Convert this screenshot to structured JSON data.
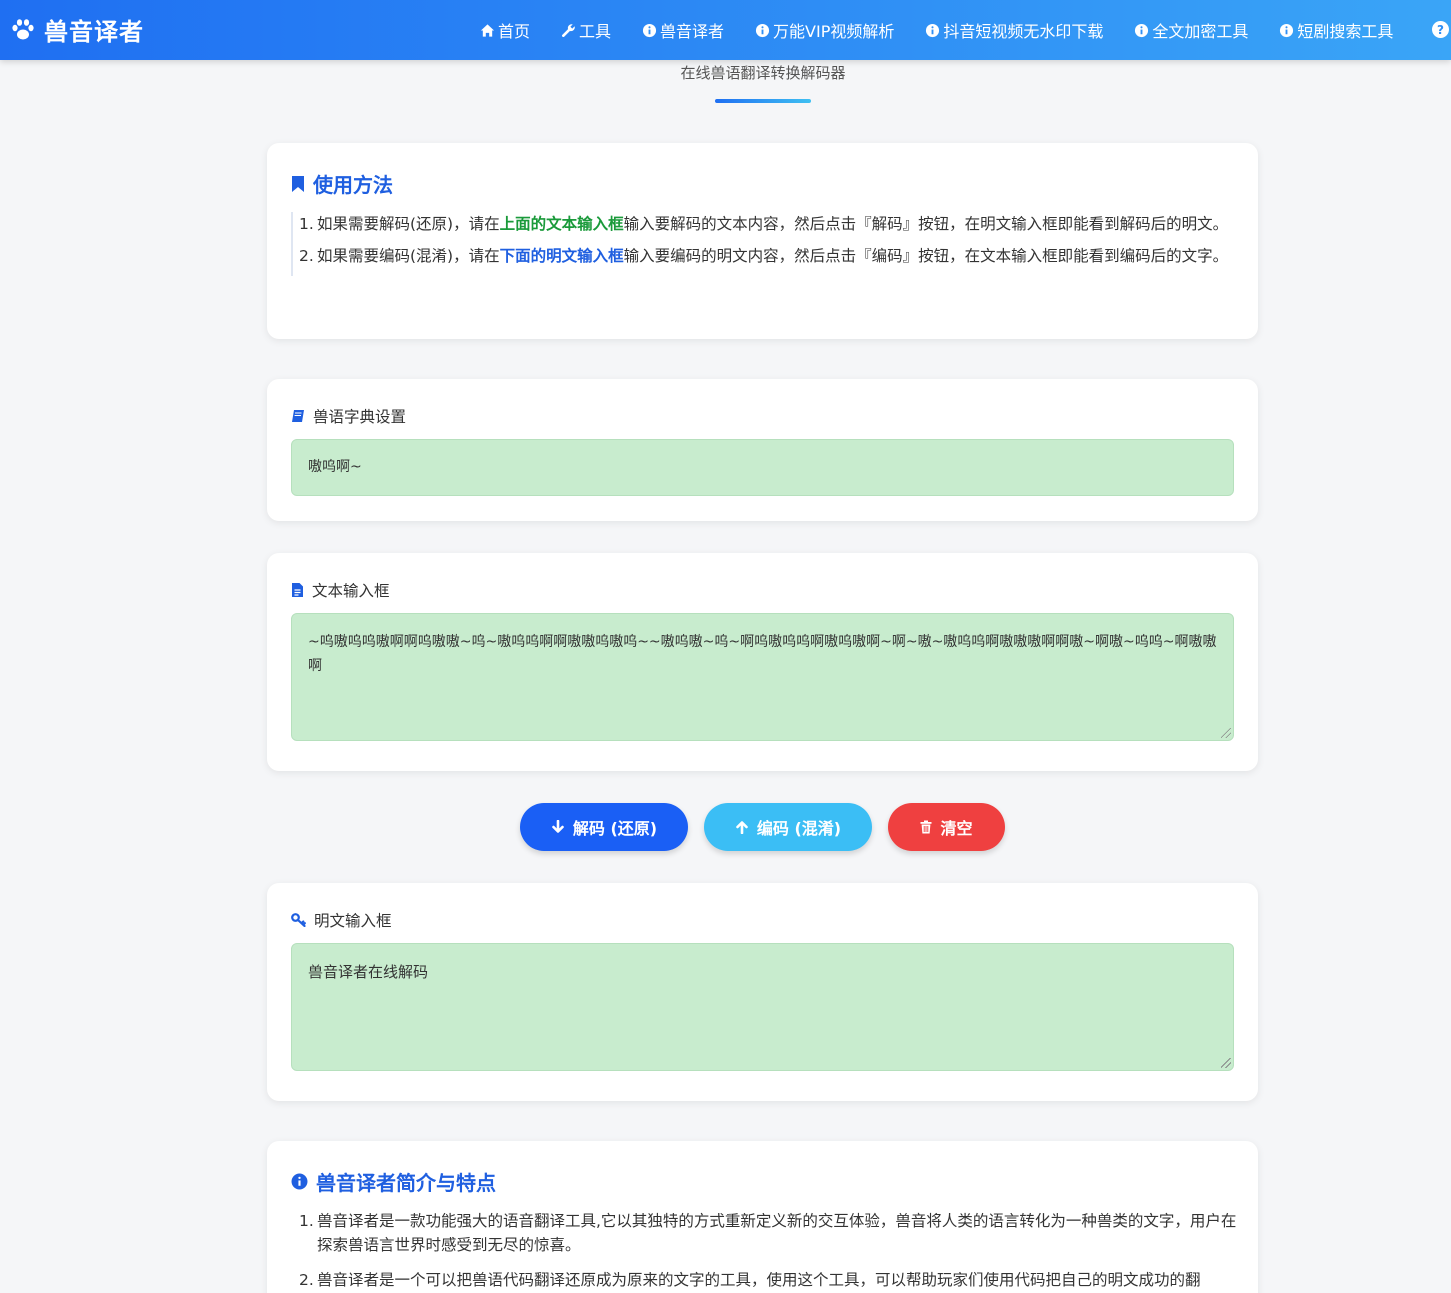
{
  "colors": {
    "nav_gradient_start": "#1f6ff2",
    "nav_gradient_end": "#3aa5f7",
    "title_blue": "#1f5fe0",
    "field_bg": "#c8ecce",
    "decode_btn": "#1a5ff5",
    "encode_btn": "#3bbef5",
    "clear_btn": "#ef4040"
  },
  "nav": {
    "brand": "兽音译者",
    "links": [
      {
        "label": "首页",
        "icon": "home-icon"
      },
      {
        "label": "工具",
        "icon": "wrench-icon"
      },
      {
        "label": "兽音译者",
        "icon": "info-icon"
      },
      {
        "label": "万能VIP视频解析",
        "icon": "info-icon"
      },
      {
        "label": "抖音短视频无水印下载",
        "icon": "info-icon"
      },
      {
        "label": "全文加密工具",
        "icon": "info-icon"
      },
      {
        "label": "短剧搜索工具",
        "icon": "info-icon"
      }
    ],
    "help": "?"
  },
  "subtitle": "在线兽语翻译转换解码器",
  "usage": {
    "title": "使用方法",
    "items": [
      {
        "n": "1.",
        "pre": "如果需要解码(还原)，请在",
        "hl": "上面的文本输入框",
        "post": "输入要解码的文本内容，然后点击『解码』按钮，在明文输入框即能看到解码后的明文。"
      },
      {
        "n": "2.",
        "pre": "如果需要编码(混淆)，请在",
        "hl": "下面的明文输入框",
        "post": "输入要编码的明文内容，然后点击『编码』按钮，在文本输入框即能看到编码后的文字。"
      }
    ]
  },
  "dict": {
    "label": "兽语字典设置",
    "value": "嗷呜啊~"
  },
  "text_input": {
    "label": "文本输入框",
    "value": "~呜嗷呜呜嗷啊啊呜嗷嗷~呜~嗷呜呜啊啊嗷嗷呜嗷呜~~嗷呜嗷~呜~啊呜嗷呜呜啊嗷呜嗷啊~啊~嗷~嗷呜呜啊嗷嗷嗷啊啊嗷~啊嗷~呜呜~啊嗷嗷啊"
  },
  "buttons": {
    "decode": "解码 (还原)",
    "encode": "编码 (混淆)",
    "clear": "清空"
  },
  "plain_input": {
    "label": "明文输入框",
    "value": "兽音译者在线解码"
  },
  "intro": {
    "title": "兽音译者简介与特点",
    "items": [
      {
        "n": "1.",
        "text": "兽音译者是一款功能强大的语音翻译工具,它以其独特的方式重新定义新的交互体验，兽音将人类的语言转化为一种兽类的文字，用户在探索兽语言世界时感受到无尽的惊喜。"
      },
      {
        "n": "2.",
        "text": "兽音译者是一个可以把兽语代码翻译还原成为原来的文字的工具，使用这个工具，可以帮助玩家们使用代码把自己的明文成功的翻"
      }
    ]
  }
}
